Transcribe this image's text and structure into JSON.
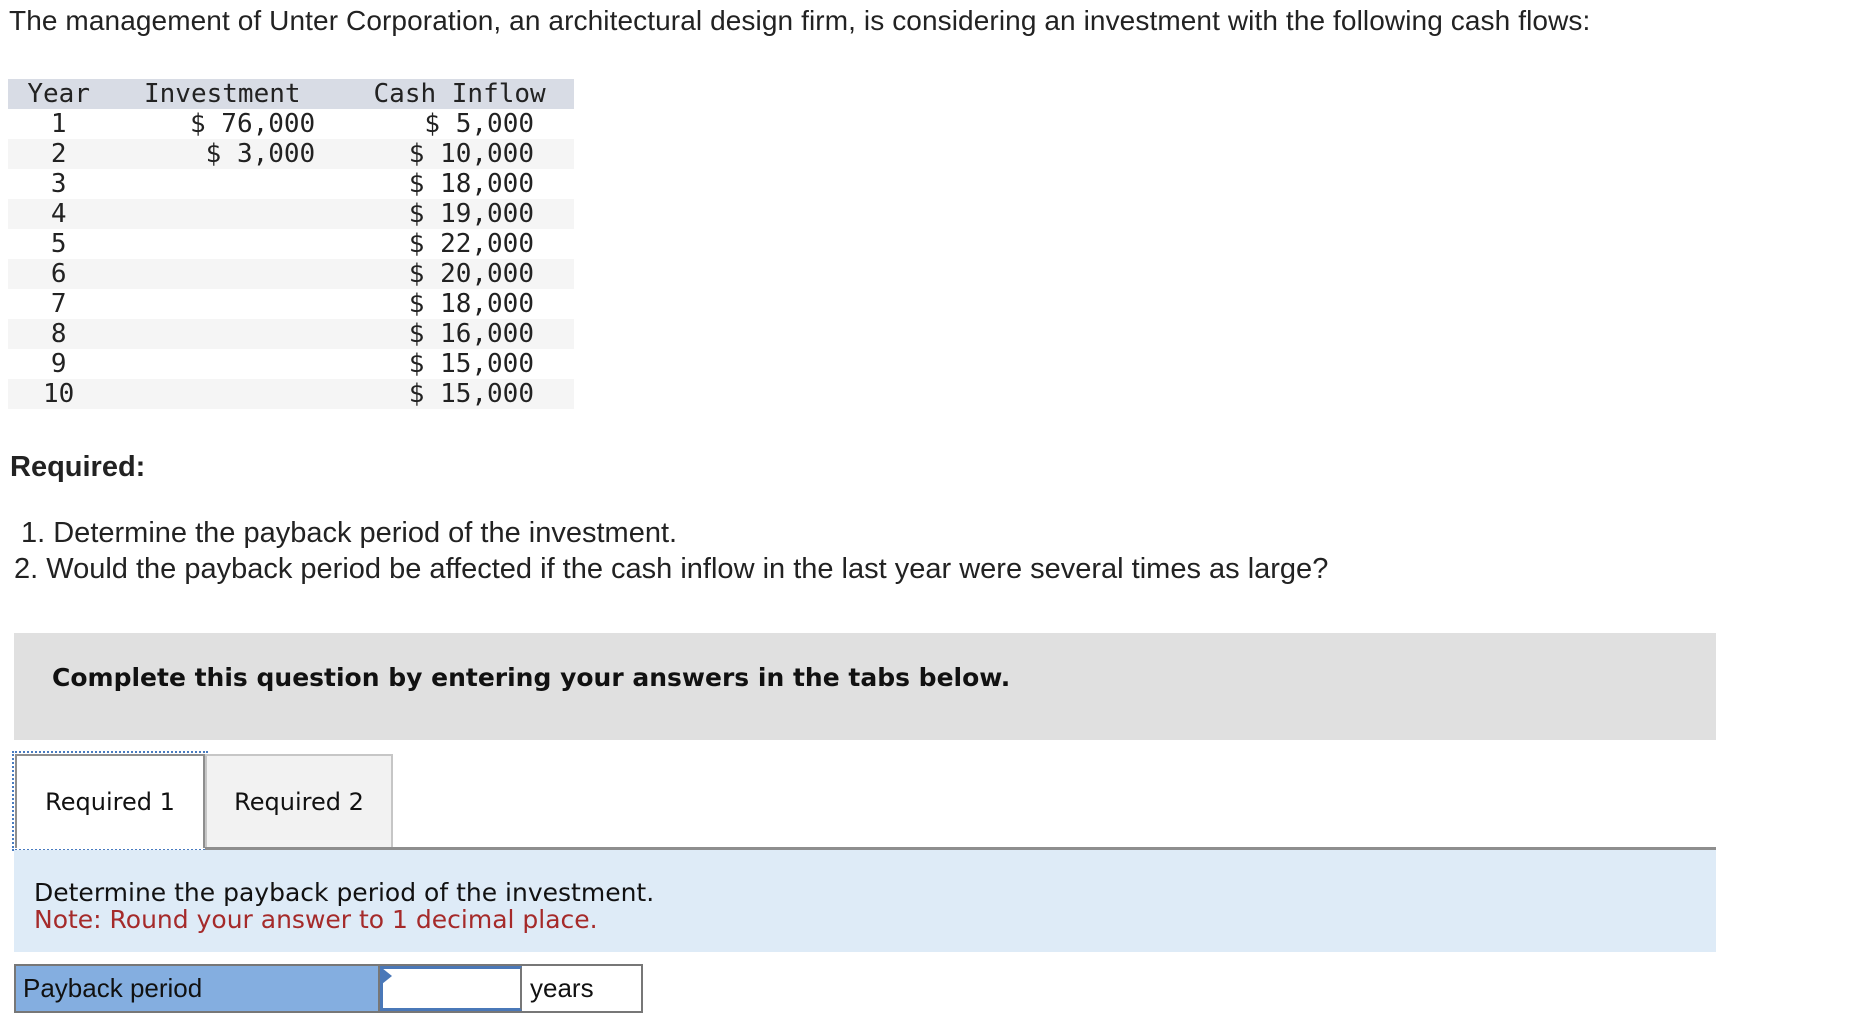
{
  "intro": "The management of Unter Corporation, an architectural design firm, is considering an investment with the following cash flows:",
  "table": {
    "headers": [
      "Year",
      "Investment",
      "Cash Inflow"
    ],
    "rows": [
      {
        "year": "1",
        "investment": "$ 76,000",
        "cash_inflow": "$ 5,000"
      },
      {
        "year": "2",
        "investment": "$ 3,000",
        "cash_inflow": "$ 10,000"
      },
      {
        "year": "3",
        "investment": "",
        "cash_inflow": "$ 18,000"
      },
      {
        "year": "4",
        "investment": "",
        "cash_inflow": "$ 19,000"
      },
      {
        "year": "5",
        "investment": "",
        "cash_inflow": "$ 22,000"
      },
      {
        "year": "6",
        "investment": "",
        "cash_inflow": "$ 20,000"
      },
      {
        "year": "7",
        "investment": "",
        "cash_inflow": "$ 18,000"
      },
      {
        "year": "8",
        "investment": "",
        "cash_inflow": "$ 16,000"
      },
      {
        "year": "9",
        "investment": "",
        "cash_inflow": "$ 15,000"
      },
      {
        "year": "10",
        "investment": "",
        "cash_inflow": "$ 15,000"
      }
    ]
  },
  "required": {
    "title": "Required:",
    "items": [
      "1. Determine the payback period of the investment.",
      "2. Would the payback period be affected if the cash inflow in the last year were several times as large?"
    ]
  },
  "banner": {
    "text": "Complete this question by entering your answers in the tabs below."
  },
  "tabs": [
    {
      "label": "Required 1",
      "active": true
    },
    {
      "label": "Required 2",
      "active": false
    }
  ],
  "panel": {
    "instruction": "Determine the payback period of the investment.",
    "note": "Note: Round your answer to 1 decimal place.",
    "note_color": "#a52a2a"
  },
  "answer": {
    "label": "Payback period",
    "value": "",
    "placeholder": "",
    "unit": "years"
  }
}
